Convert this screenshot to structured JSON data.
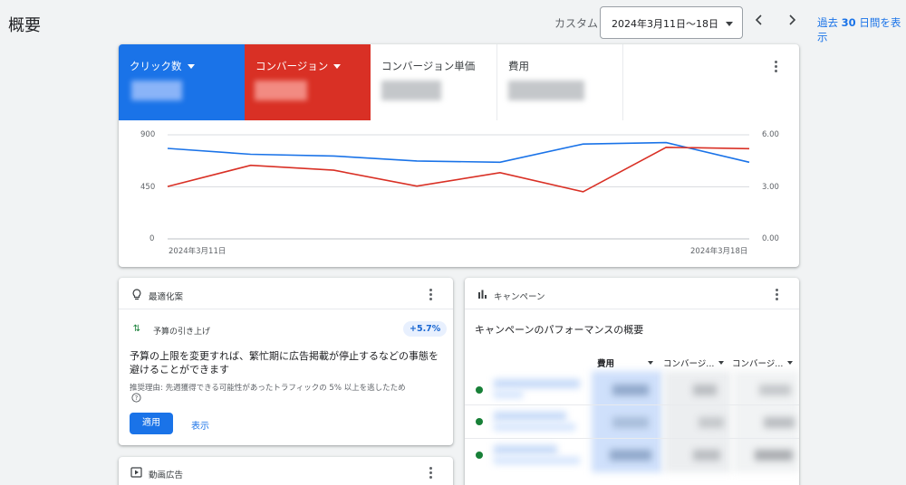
{
  "header": {
    "page_title": "概要",
    "custom_label": "カスタム",
    "date_range": "2024年3月11日～18日",
    "show_last": "過去",
    "show_days": "30",
    "show_suffix": "日間を表示"
  },
  "metrics": [
    {
      "label": "クリック数",
      "color": "#1a73e8",
      "has_dropdown": true
    },
    {
      "label": "コンバージョン",
      "color": "#d93025",
      "has_dropdown": true
    },
    {
      "label": "コンバージョン単価",
      "color": "#ffffff",
      "has_dropdown": false
    },
    {
      "label": "費用",
      "color": "#ffffff",
      "has_dropdown": false
    }
  ],
  "chart_data": {
    "type": "line",
    "x": [
      "2024-03-11",
      "2024-03-12",
      "2024-03-13",
      "2024-03-14",
      "2024-03-15",
      "2024-03-16",
      "2024-03-17",
      "2024-03-18"
    ],
    "x_tick_labels": [
      "2024年3月11日",
      "2024年3月18日"
    ],
    "y_left": {
      "ticks": [
        "900",
        "450",
        "0"
      ],
      "range": [
        0,
        900
      ]
    },
    "y_right": {
      "ticks": [
        "6.00",
        "3.00",
        "0.00"
      ],
      "range": [
        0,
        6
      ]
    },
    "series": [
      {
        "axis": "left",
        "color": "#1a73e8",
        "values": [
          783,
          732,
          717,
          674,
          663,
          820,
          833,
          663
        ]
      },
      {
        "axis": "right",
        "color": "#d93025",
        "values": [
          3.02,
          4.24,
          3.96,
          3.04,
          3.82,
          2.72,
          5.28,
          5.2
        ]
      }
    ],
    "grid": true,
    "legend": "none"
  },
  "recommendations": {
    "title": "最適化案",
    "item_title": "予算の引き上げ",
    "badge": "+5.7%",
    "description_line1": "予算の上限を変更すれば、繁忙期に広告掲載が停止するなどの事態を",
    "description_line2": "避けることができます",
    "reason": "推奨理由: 先週獲得できる可能性があったトラフィックの 5% 以上を逃したため",
    "help_icon": "help-circle-icon",
    "apply_label": "適用",
    "view_label": "表示"
  },
  "video_ads": {
    "title": "動画広告"
  },
  "campaigns": {
    "title": "キャンペーン",
    "subtitle": "キャンペーンのパフォーマンスの概要",
    "columns": [
      "費用",
      "コンバージ...",
      "コンバージ..."
    ],
    "row_count": 3
  }
}
